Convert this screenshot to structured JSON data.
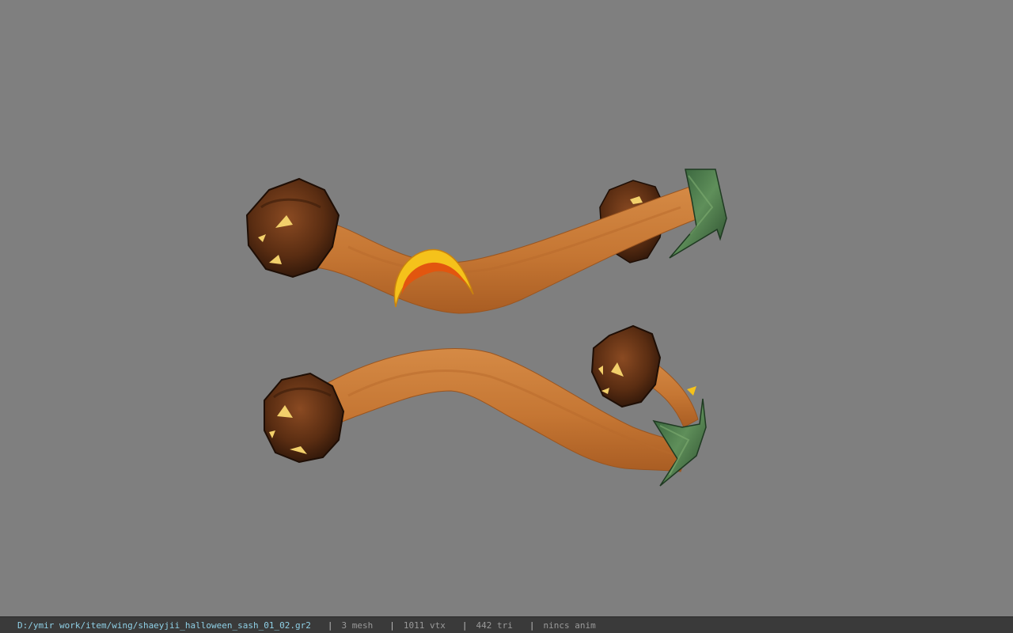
{
  "viewport": {
    "background": "#7f7f7f",
    "model": {
      "name": "halloween-sash",
      "parts": [
        "pumpkin-head-top-left",
        "pumpkin-head-top-right",
        "pumpkin-head-bottom-left",
        "pumpkin-head-bottom-right",
        "crescent-moon-ornament",
        "leaf-tip-top",
        "leaf-tip-bottom"
      ],
      "colors": {
        "sash": "#c97a35",
        "sash_dark": "#a85e24",
        "pumpkin": "#5a2f14",
        "pumpkin_edge": "#2b150a",
        "eyes": "#f2d06b",
        "moon_outer": "#f5c21b",
        "moon_inner": "#e2560f",
        "leaf": "#4a7a4a",
        "leaf_dark": "#2f5232"
      }
    }
  },
  "statusbar": {
    "path": "D:/ymir work/item/wing/shaeyjii_halloween_sash_01_02.gr2",
    "separator": "|",
    "mesh": "3 mesh",
    "vtx": "1011 vtx",
    "tri": "442 tri",
    "anim": "nincs anim",
    "colors": {
      "background": "#3a3a3a",
      "path": "#8fd0e6",
      "stats": "#9a9a9a"
    }
  }
}
